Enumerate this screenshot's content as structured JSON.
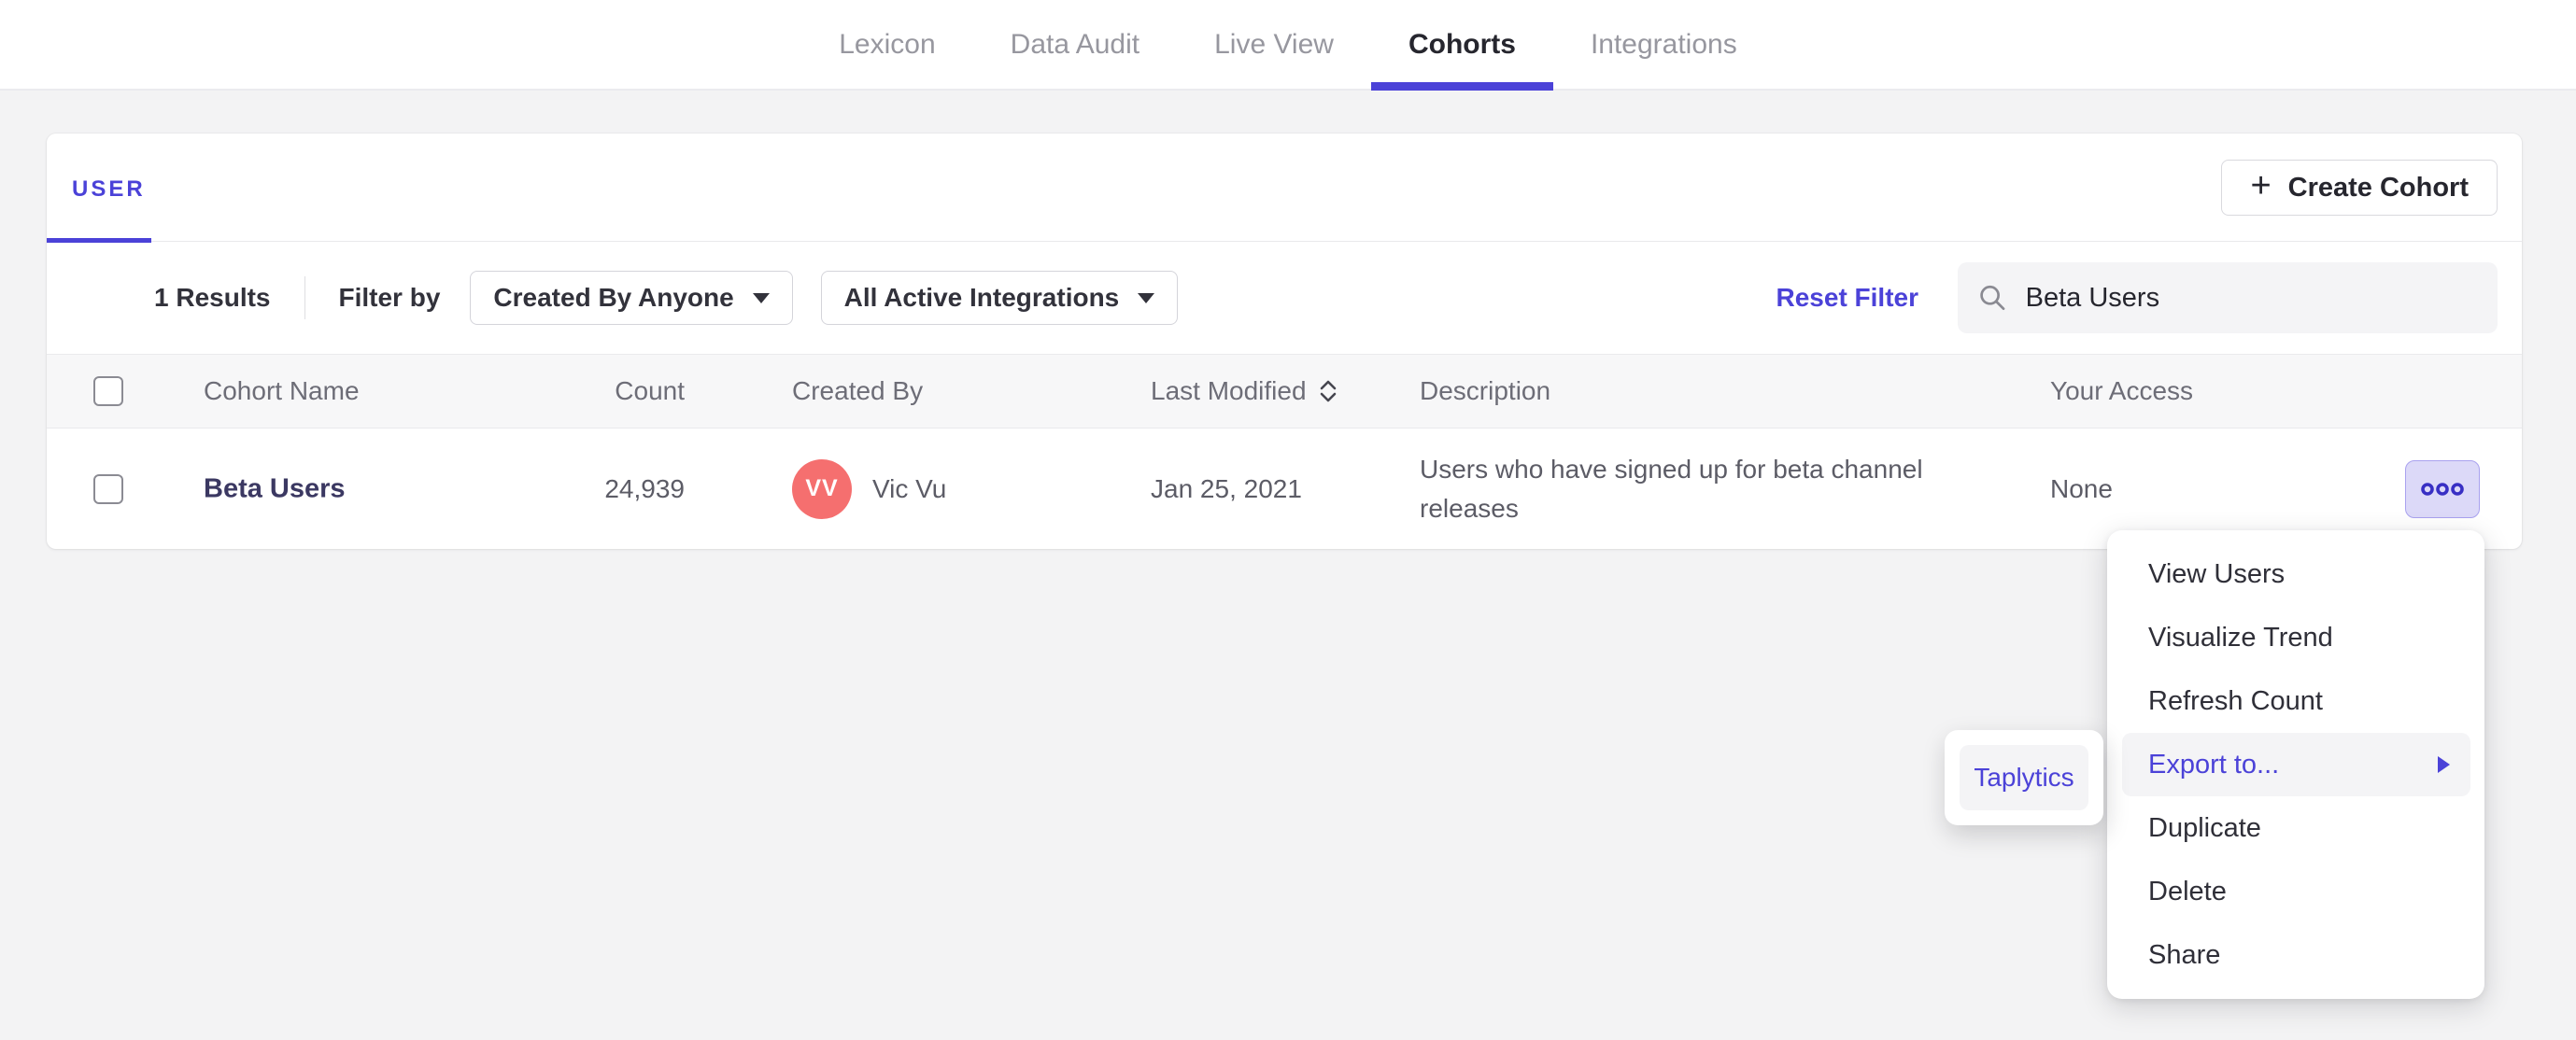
{
  "nav": {
    "tabs": [
      {
        "label": "Lexicon",
        "active": false
      },
      {
        "label": "Data Audit",
        "active": false
      },
      {
        "label": "Live View",
        "active": false
      },
      {
        "label": "Cohorts",
        "active": true
      },
      {
        "label": "Integrations",
        "active": false
      }
    ]
  },
  "panel": {
    "tab_label": "USER",
    "create_button": {
      "plus": "+",
      "label": "Create Cohort"
    },
    "filters": {
      "results_count": "1 Results",
      "filter_by_label": "Filter by",
      "created_by_dropdown": "Created By Anyone",
      "integrations_dropdown": "All Active Integrations",
      "reset_label": "Reset Filter",
      "search": {
        "value": "Beta Users"
      }
    },
    "table": {
      "columns": [
        "Cohort Name",
        "Count",
        "Created By",
        "Last Modified",
        "Description",
        "Your Access"
      ],
      "rows": [
        {
          "name": "Beta Users",
          "count": "24,939",
          "created_by": {
            "initials": "VV",
            "name": "Vic Vu"
          },
          "last_modified": "Jan 25, 2021",
          "description": "Users who have signed up for beta channel releases",
          "access": "None"
        }
      ]
    }
  },
  "context_menu": {
    "items": [
      {
        "label": "View Users"
      },
      {
        "label": "Visualize Trend"
      },
      {
        "label": "Refresh Count"
      },
      {
        "label": "Export to...",
        "highlighted": true,
        "has_submenu": true
      },
      {
        "label": "Duplicate"
      },
      {
        "label": "Delete"
      },
      {
        "label": "Share"
      }
    ],
    "submenu": {
      "items": [
        {
          "label": "Taplytics"
        }
      ]
    }
  },
  "colors": {
    "accent": "#4b42d8",
    "avatar": "#f56f6f",
    "menu_button_bg": "#dcd9f8",
    "page_bg": "#f3f3f4"
  }
}
